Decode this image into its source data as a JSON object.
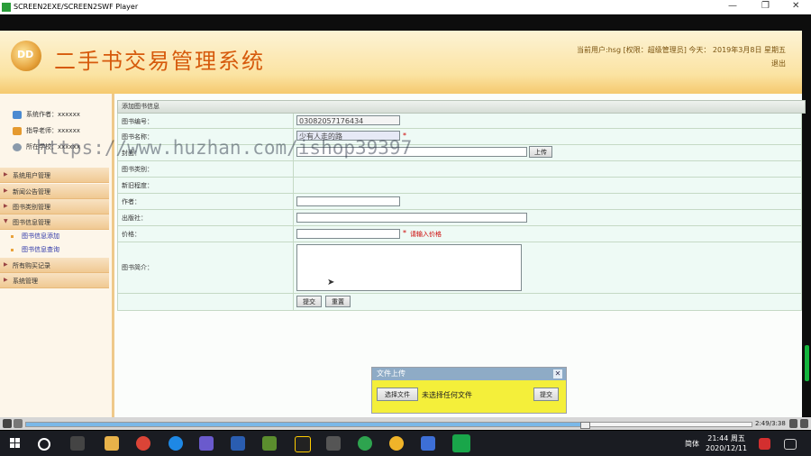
{
  "window": {
    "title": "SCREEN2EXE/SCREEN2SWF Player"
  },
  "app": {
    "title": "二手书交易管理系统",
    "logo_text": "DD",
    "user_info": "当前用户:hsg [权限：超级管理员] 今天： 2019年3月8日 星期五",
    "logout": "退出"
  },
  "sidebar": {
    "meta": [
      {
        "label": "系统作者：xxxxxx",
        "icon": "user-group-icon"
      },
      {
        "label": "指导老师：xxxxxx",
        "icon": "teacher-icon"
      },
      {
        "label": "所在学校：xxxxxx",
        "icon": "school-icon"
      }
    ],
    "menus": [
      {
        "label": "系统用户管理"
      },
      {
        "label": "新闻公告管理"
      },
      {
        "label": "图书类别管理"
      },
      {
        "label": "图书信息管理"
      },
      {
        "label": "所有购买记录"
      },
      {
        "label": "系统管理"
      }
    ],
    "submenu": [
      {
        "label": "图书信息添加"
      },
      {
        "label": "图书信息查询"
      }
    ]
  },
  "form": {
    "header": "添加图书信息",
    "fields": {
      "book_no": {
        "label": "图书编号：",
        "value": "03082057176434"
      },
      "book_name": {
        "label": "图书名称：",
        "value": "少有人走的路"
      },
      "cover": {
        "label": "封面：",
        "upload_label": "上传"
      },
      "category": {
        "label": "图书类别："
      },
      "condition": {
        "label": "新旧程度："
      },
      "author": {
        "label": "作者："
      },
      "publisher": {
        "label": "出版社："
      },
      "price": {
        "label": "价格：",
        "hint": "请输入价格"
      },
      "intro": {
        "label": "图书简介："
      }
    },
    "required_mark": "*",
    "submit": "提交",
    "reset": "重置"
  },
  "watermark": "https://www.huzhan.com/ishop39397",
  "upload_dialog": {
    "title": "文件上传",
    "choose": "选择文件",
    "status": "未选择任何文件",
    "submit": "提交"
  },
  "player": {
    "time": "2:49/3:38",
    "progress": 0.77
  },
  "taskbar": {
    "lang": "简体",
    "time": "21:44 周五",
    "date": "2020/12/11"
  },
  "colors": {
    "accent": "#d65a0c",
    "header_bg": "#fbe3a2",
    "form_bg": "#eefaf5",
    "dialog_bg": "#f4ef3a"
  }
}
